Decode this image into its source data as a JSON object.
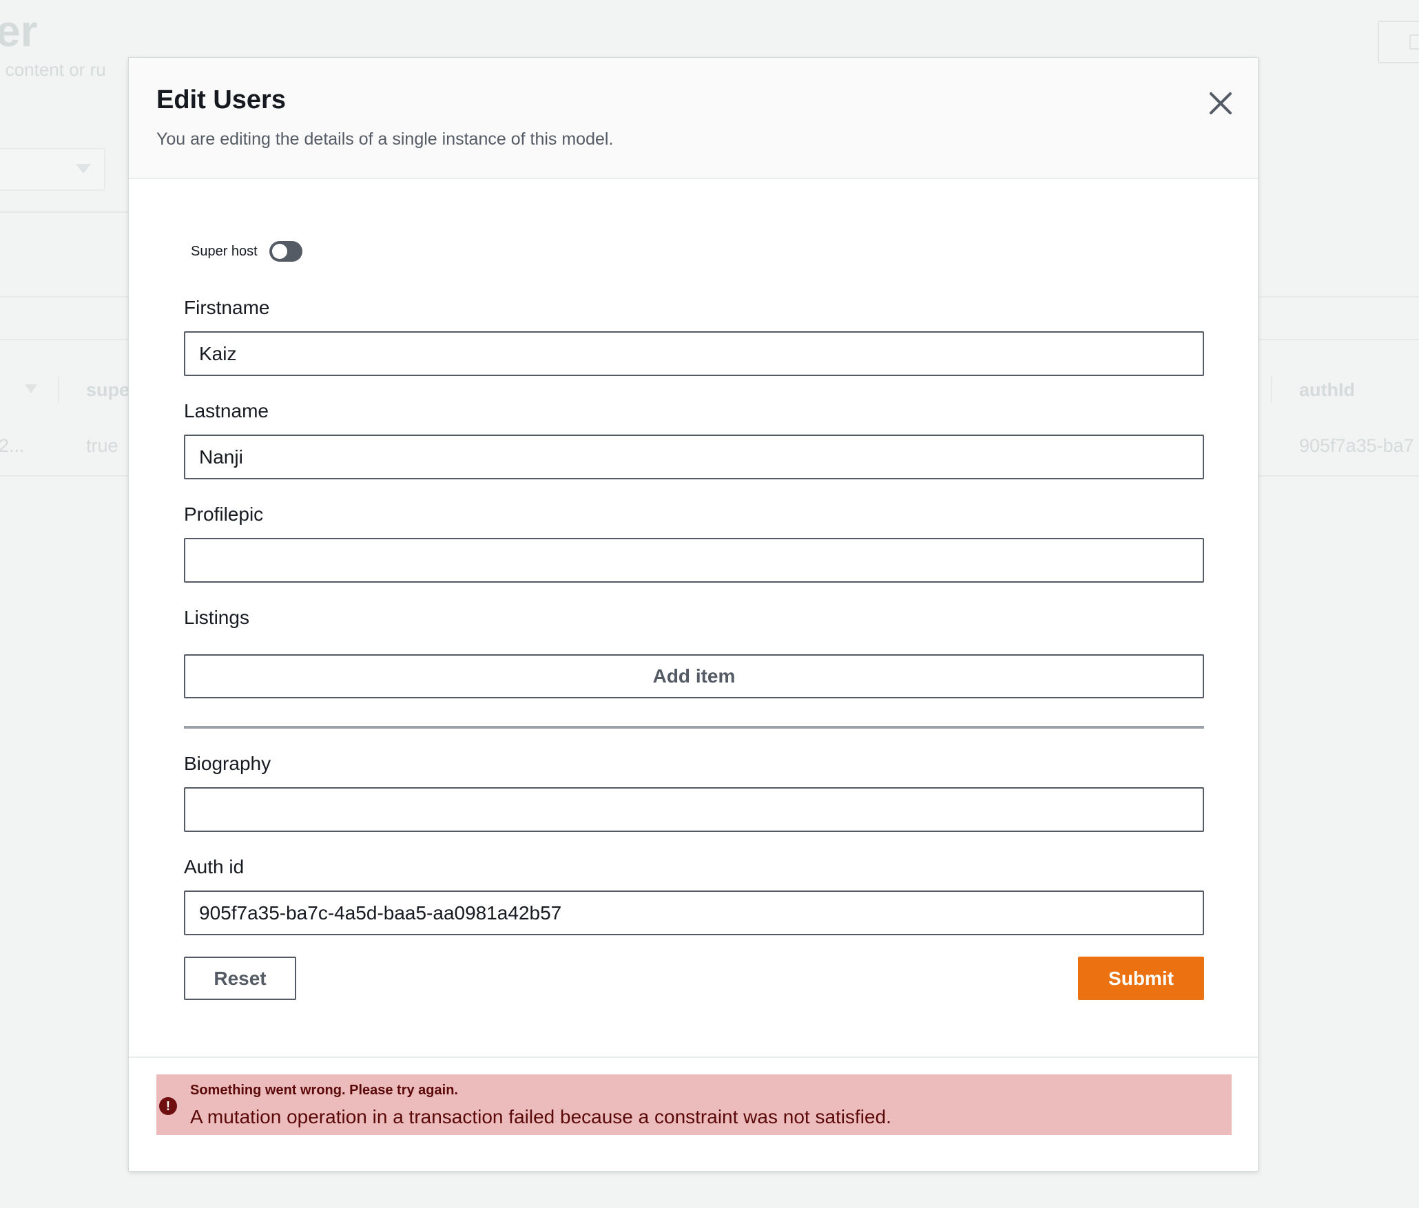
{
  "background": {
    "title_fragment": "er",
    "subtitle_fragment": "o content or ru",
    "table": {
      "headers": [
        "supe",
        "authId"
      ],
      "row": {
        "id_fragment": "2...",
        "superhost": "true",
        "authid": "905f7a35-ba7"
      }
    }
  },
  "modal": {
    "title": "Edit Users",
    "description": "You are editing the details of a single instance of this model.",
    "close_icon": "close-icon",
    "superhost": {
      "label": "Super host",
      "checked": false
    },
    "fields": {
      "firstname": {
        "label": "Firstname",
        "value": "Kaiz"
      },
      "lastname": {
        "label": "Lastname",
        "value": "Nanji"
      },
      "profilepic": {
        "label": "Profilepic",
        "value": ""
      },
      "listings": {
        "label": "Listings",
        "add_label": "Add item"
      },
      "biography": {
        "label": "Biography",
        "value": ""
      },
      "authid": {
        "label": "Auth id",
        "value": "905f7a35-ba7c-4a5d-baa5-aa0981a42b57"
      }
    },
    "buttons": {
      "reset": "Reset",
      "submit": "Submit"
    },
    "error": {
      "icon": "error-icon",
      "title": "Something went wrong. Please try again.",
      "message": "A mutation operation in a transaction failed because a constraint was not satisfied."
    }
  },
  "colors": {
    "primary": "#ec7211",
    "error_bg": "#ecbcbc",
    "error_text": "#5a0808",
    "toggle_off": "#545b64"
  }
}
